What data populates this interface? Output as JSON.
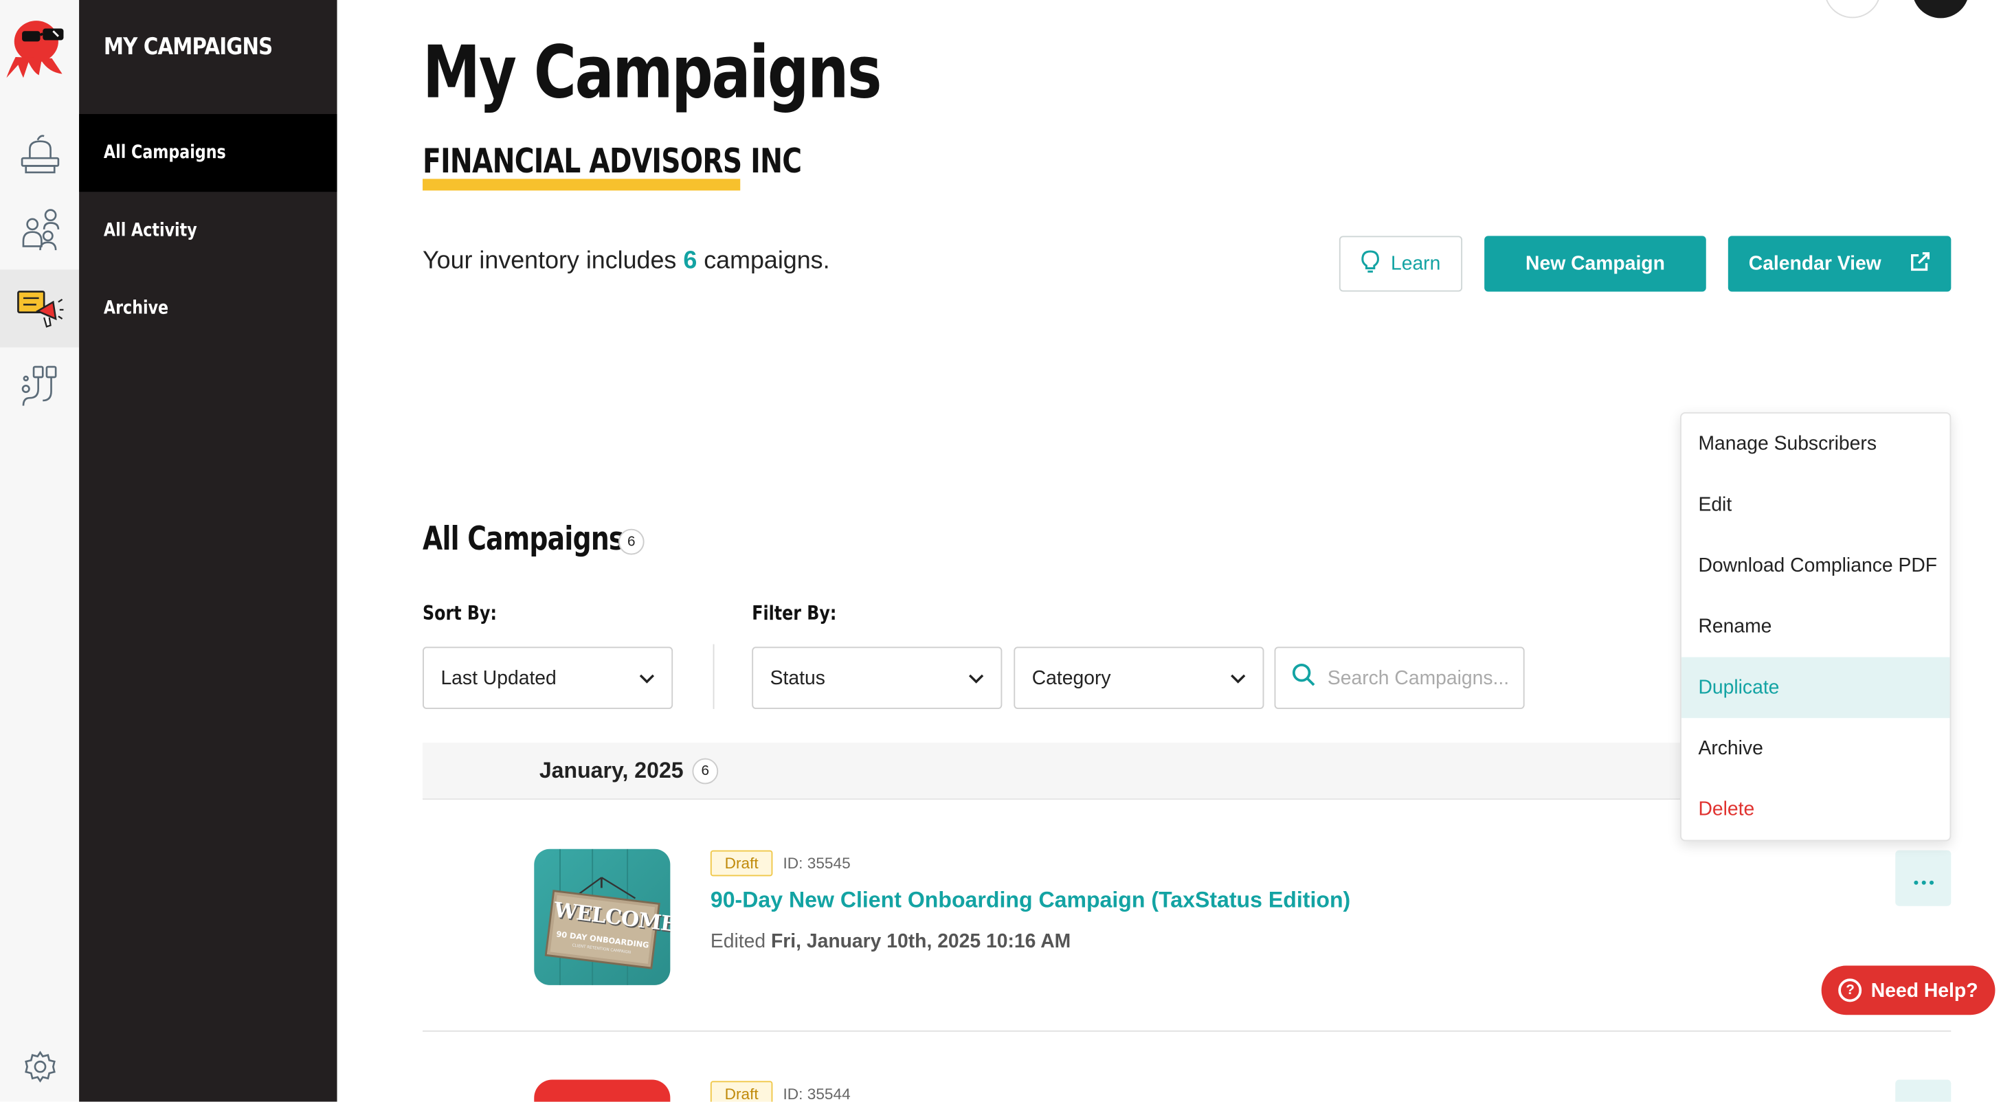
{
  "sidebar": {
    "title": "MY CAMPAIGNS",
    "items": [
      {
        "label": "All Campaigns"
      },
      {
        "label": "All Activity"
      },
      {
        "label": "Archive"
      }
    ]
  },
  "rail": {
    "icons": [
      "logo-icon",
      "inbox-tray-icon",
      "people-icon",
      "campaign-megaphone-icon",
      "integrations-icon",
      "settings-gear-icon"
    ]
  },
  "header": {
    "title": "My Campaigns",
    "org_name": "FINANCIAL ADVISORS INC",
    "inventory_prefix": "Your inventory includes",
    "inventory_count": "6",
    "inventory_suffix": "campaigns.",
    "learn_label": "Learn",
    "new_campaign_label": "New Campaign",
    "calendar_view_label": "Calendar View"
  },
  "list": {
    "section_title": "All Campaigns",
    "section_count": "6",
    "sort_label": "Sort By:",
    "sort_value": "Last Updated",
    "filter_label": "Filter By:",
    "status_value": "Status",
    "category_value": "Category",
    "search_placeholder": "Search Campaigns...",
    "month_label": "January, 2025",
    "month_count": "6",
    "campaigns": [
      {
        "status": "Draft",
        "id": "ID: 35545",
        "name": "90-Day New Client Onboarding Campaign (TaxStatus Edition)",
        "edited_prefix": "Edited",
        "edited_date": "Fri, January 10th, 2025 10:16 AM",
        "thumb_title": "WELCOME",
        "thumb_sub": "90 DAY ONBOARDING",
        "thumb_caption": "CLIENT RETENTION CAMPAIGN"
      },
      {
        "status": "Draft",
        "id": "ID: 35544"
      }
    ]
  },
  "menu": {
    "items": [
      {
        "label": "Manage Subscribers"
      },
      {
        "label": "Edit"
      },
      {
        "label": "Download Compliance PDF"
      },
      {
        "label": "Rename"
      },
      {
        "label": "Duplicate"
      },
      {
        "label": "Archive"
      },
      {
        "label": "Delete"
      }
    ]
  },
  "help": {
    "label": "Need Help?"
  },
  "colors": {
    "accent": "#13a3a3",
    "brand_red": "#e0322f",
    "underline": "#f7c12d",
    "sidebar": "#231f20"
  }
}
